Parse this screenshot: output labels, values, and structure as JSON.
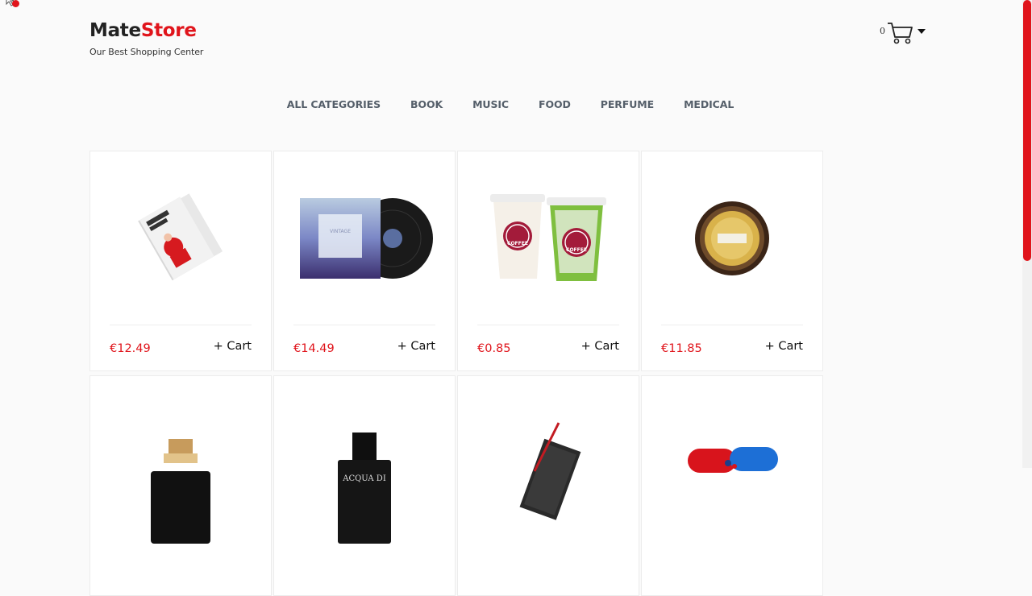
{
  "brand": {
    "name_part1": "Mate",
    "name_part2": "Store",
    "tagline": "Our Best Shopping Center"
  },
  "cart": {
    "count": "0",
    "icon": "shopping-cart-icon"
  },
  "nav": {
    "items": [
      {
        "label": "ALL CATEGORIES"
      },
      {
        "label": "BOOK"
      },
      {
        "label": "MUSIC"
      },
      {
        "label": "FOOD"
      },
      {
        "label": "PERFUME"
      },
      {
        "label": "MEDICAL"
      }
    ]
  },
  "products": [
    {
      "price": "€12.49",
      "cart_label": "+ Cart",
      "image": "book-mockup-image"
    },
    {
      "price": "€14.49",
      "cart_label": "+ Cart",
      "image": "vinyl-record-image"
    },
    {
      "price": "€0.85",
      "cart_label": "+ Cart",
      "image": "coffee-cups-image"
    },
    {
      "price": "€11.85",
      "cart_label": "+ Cart",
      "image": "chocolate-praline-image"
    },
    {
      "price": "",
      "cart_label": "",
      "image": "perfume-bottle-gold-image"
    },
    {
      "price": "",
      "cart_label": "",
      "image": "perfume-bottle-black-image"
    },
    {
      "price": "",
      "cart_label": "",
      "image": "notebook-pen-image"
    },
    {
      "price": "",
      "cart_label": "",
      "image": "capsule-pills-image"
    }
  ],
  "product_labels": {
    "vinyl_title": "VINTAGE",
    "coffee_cup": "COFFEE",
    "perfume_label": "ACQUA DI"
  },
  "colors": {
    "accent": "#e0141b",
    "text": "#222222",
    "nav": "#555f6a"
  }
}
